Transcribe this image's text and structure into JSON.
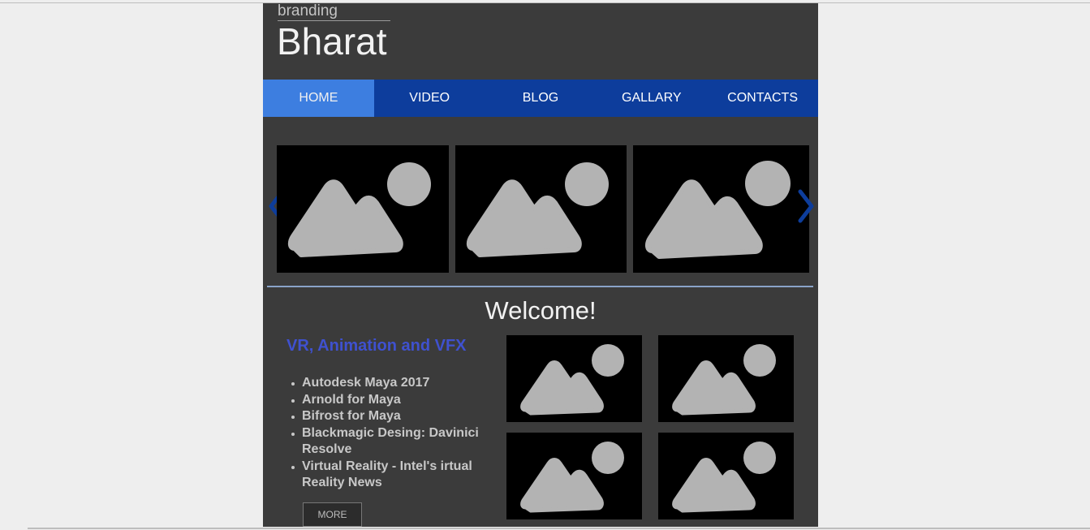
{
  "header": {
    "branding": "branding",
    "title": "Bharat"
  },
  "nav": {
    "items": [
      {
        "label": "HOME",
        "active": true
      },
      {
        "label": "VIDEO",
        "active": false
      },
      {
        "label": "BLOG",
        "active": false
      },
      {
        "label": "GALLARY",
        "active": false
      },
      {
        "label": "CONTACTS",
        "active": false
      }
    ]
  },
  "slider": {
    "prev_icon": "chevron-left-icon",
    "next_icon": "chevron-right-icon",
    "images": [
      "image-placeholder-icon",
      "image-placeholder-icon",
      "image-placeholder-icon"
    ]
  },
  "main": {
    "welcome": "Welcome!",
    "heading": "VR, Animation and VFX",
    "list": [
      "Autodesk Maya 2017",
      "Arnold for Maya",
      "Bifrost for Maya",
      "Blackmagic Desing: Davinici Resolve",
      "Virtual Reality - Intel's irtual Reality News"
    ],
    "more_label": "MORE",
    "gallery": [
      "image-placeholder-icon",
      "image-placeholder-icon",
      "image-placeholder-icon",
      "image-placeholder-icon"
    ]
  },
  "colors": {
    "page_bg": "#3b3b3b",
    "nav_bg": "#0d3d9c",
    "nav_active": "#3d7ee0",
    "heading": "#3f51cf"
  }
}
